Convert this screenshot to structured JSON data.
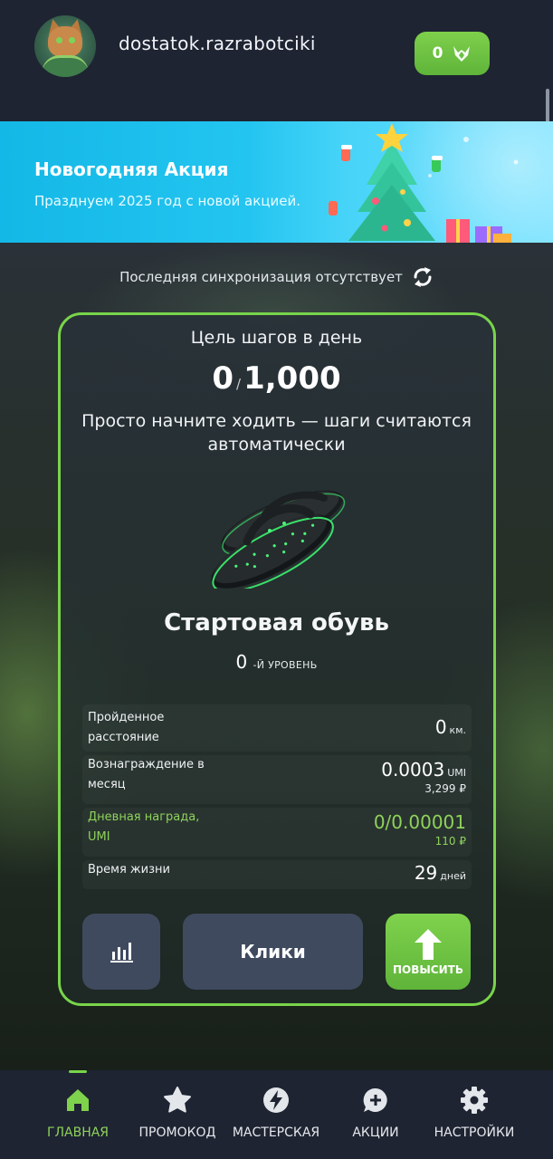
{
  "header": {
    "username": "dostatok.razrabotciki",
    "coin_balance": "0",
    "coin_icon": "fox-token-icon"
  },
  "banner": {
    "title": "Новогодняя Акция",
    "subtitle": "Празднуем 2025 год с новой акцией.",
    "image": "christmas-tree-illustration"
  },
  "sync": {
    "text": "Последняя синхронизация отсутствует",
    "icon": "sync-icon"
  },
  "card": {
    "goal_label": "Цель шагов в день",
    "steps_current": "0",
    "steps_goal": "1,000",
    "hint": "Просто начните ходить — шаги считаются автоматически",
    "shoe_name": "Стартовая обувь",
    "level_value": "0",
    "level_suffix": "-Й УРОВЕНЬ",
    "stats": {
      "distance_label": "Пройденное расстояние",
      "distance_value": "0",
      "distance_unit": "км.",
      "monthly_label": "Вознаграждение в месяц",
      "monthly_value": "0.0003",
      "monthly_unit": "UMI",
      "monthly_rub": "3,299 ₽",
      "daily_label": "Дневная награда, UMI",
      "daily_value": "0/0.00001",
      "daily_rub": "110 ₽",
      "lifetime_label": "Время жизни",
      "lifetime_value": "29",
      "lifetime_unit": "дней"
    },
    "buttons": {
      "stats_icon": "bar-chart-icon",
      "clicks_label": "Клики",
      "upgrade_label": "ПОВЫСИТЬ"
    }
  },
  "nav": {
    "items": [
      {
        "label": "ГЛАВНАЯ",
        "icon": "home-icon",
        "active": true
      },
      {
        "label": "ПРОМОКОД",
        "icon": "star-icon",
        "active": false
      },
      {
        "label": "МАСТЕРСКАЯ",
        "icon": "lightning-icon",
        "active": false
      },
      {
        "label": "АКЦИИ",
        "icon": "chat-plus-icon",
        "active": false
      },
      {
        "label": "НАСТРОЙКИ",
        "icon": "gear-icon",
        "active": false
      }
    ]
  },
  "colors": {
    "accent_green": "#79d44b",
    "text_green": "#8fd25b",
    "button_gray": "#3f4a5f",
    "nav_bg": "#1e2432"
  }
}
